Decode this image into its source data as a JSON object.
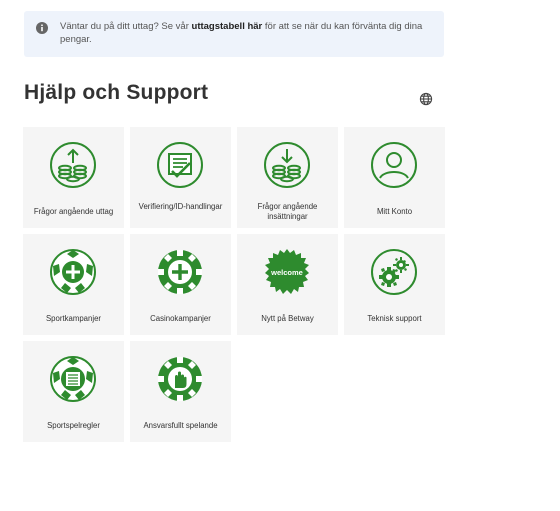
{
  "notice": {
    "icon": "info-icon",
    "text_before": "Väntar du på ditt uttag? Se vår ",
    "link": "uttagstabell här",
    "text_after": " för att se när du kan förvänta dig dina pengar."
  },
  "page": {
    "title": "Hjälp och Support",
    "language_icon": "globe-icon"
  },
  "accent": "#2e8b2e",
  "tiles": [
    {
      "label": "Frågor angående uttag",
      "icon": "coins-up-icon"
    },
    {
      "label": "Verifiering/ID-handlingar",
      "icon": "document-check-icon"
    },
    {
      "label": "Frågor angående insättningar",
      "icon": "coins-down-icon"
    },
    {
      "label": "Mitt Konto",
      "icon": "user-icon"
    },
    {
      "label": "Sportkampanjer",
      "icon": "football-plus-icon"
    },
    {
      "label": "Casinokampanjer",
      "icon": "chip-plus-icon"
    },
    {
      "label": "Nytt på Betway",
      "icon": "welcome-badge-icon",
      "badge": "welcome"
    },
    {
      "label": "Teknisk support",
      "icon": "gears-icon"
    },
    {
      "label": "Sportspelregler",
      "icon": "football-rules-icon"
    },
    {
      "label": "Ansvarsfullt spelande",
      "icon": "chip-hand-icon"
    }
  ]
}
